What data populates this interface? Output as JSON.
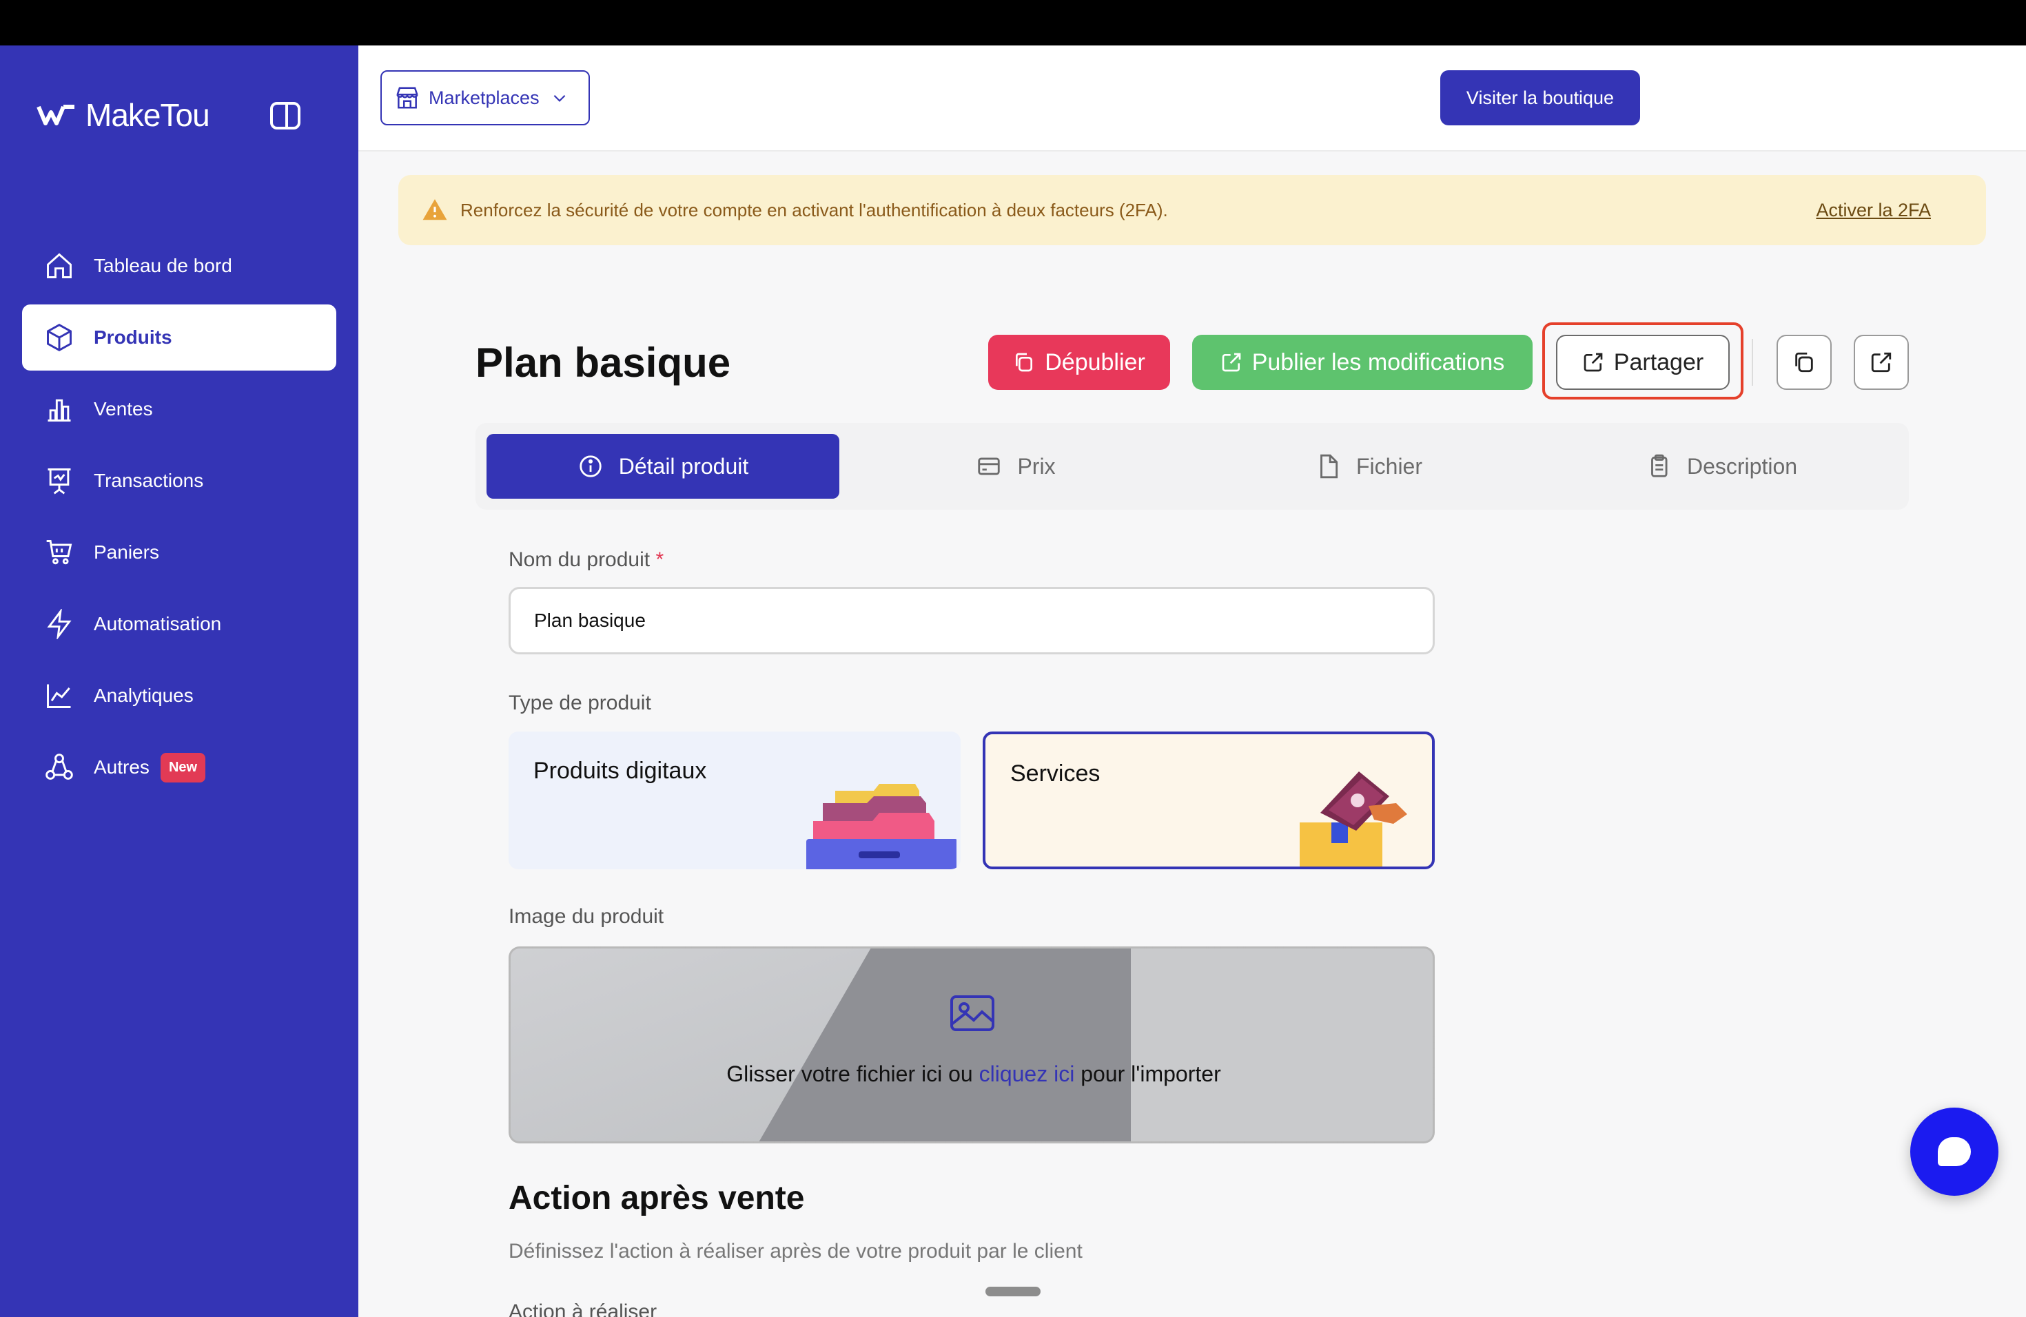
{
  "app": {
    "brand": "MakeTou",
    "accent_color": "#3434b5"
  },
  "sidebar": {
    "items": [
      {
        "label": "Tableau de bord",
        "icon": "home-icon",
        "active": false
      },
      {
        "label": "Produits",
        "icon": "box-icon",
        "active": true
      },
      {
        "label": "Ventes",
        "icon": "bar-chart-icon",
        "active": false
      },
      {
        "label": "Transactions",
        "icon": "presentation-icon",
        "active": false
      },
      {
        "label": "Paniers",
        "icon": "cart-icon",
        "active": false
      },
      {
        "label": "Automatisation",
        "icon": "lightning-icon",
        "active": false
      },
      {
        "label": "Analytiques",
        "icon": "line-chart-icon",
        "active": false
      },
      {
        "label": "Autres",
        "icon": "nodes-icon",
        "active": false,
        "badge": "New"
      }
    ]
  },
  "header": {
    "marketplace_select": "Marketplaces",
    "visit_button": "Visiter la boutique"
  },
  "alert": {
    "message": "Renforcez la sécurité de votre compte en activant l'authentification à deux facteurs (2FA).",
    "link": "Activer la 2FA",
    "color": "#fbf1cf"
  },
  "product": {
    "title": "Plan basique",
    "actions": {
      "unpublish": "Dépublier",
      "publish": "Publier les modifications",
      "share": "Partager"
    },
    "tabs": [
      {
        "label": "Détail produit",
        "icon": "info-icon",
        "active": true
      },
      {
        "label": "Prix",
        "icon": "card-icon",
        "active": false
      },
      {
        "label": "Fichier",
        "icon": "file-icon",
        "active": false
      },
      {
        "label": "Description",
        "icon": "clipboard-icon",
        "active": false
      }
    ],
    "form": {
      "name_label": "Nom du produit",
      "name_required": "*",
      "name_value": "Plan basique",
      "type_label": "Type de produit",
      "types": [
        {
          "label": "Produits digitaux",
          "selected": false
        },
        {
          "label": "Services",
          "selected": true
        }
      ],
      "image_label": "Image du produit",
      "dropzone_before": "Glisser votre fichier ici ou ",
      "dropzone_link": "cliquez ici",
      "dropzone_after": " pour l'importer"
    },
    "after_sale": {
      "title": "Action après vente",
      "subtitle": "Définissez l'action à réaliser après de votre produit par le client",
      "action_label": "Action à réaliser"
    }
  }
}
